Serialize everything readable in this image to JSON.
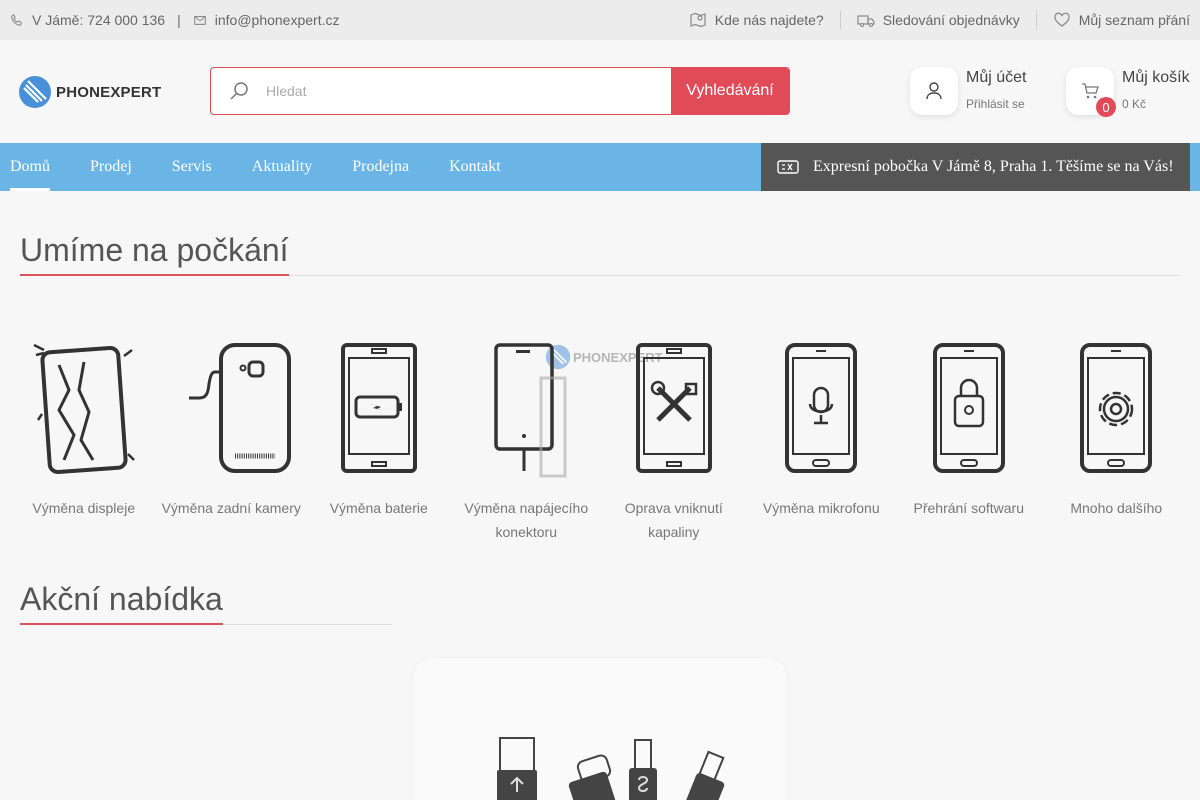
{
  "topbar": {
    "phone": "V Jámě: 724 000 136",
    "separator": "|",
    "email": "info@phonexpert.cz",
    "find_us": "Kde nás najdete?",
    "track_order": "Sledování objednávky",
    "wishlist": "Můj seznam přání"
  },
  "header": {
    "logo_text": "PHONEXPERT",
    "search_placeholder": "Hledat",
    "search_button": "Vyhledávání",
    "account_title": "Můj účet",
    "account_sub": "Přihlásit se",
    "cart_title": "Můj košík",
    "cart_sub": "0 Kč",
    "cart_count": "0"
  },
  "nav": {
    "items": [
      "Domů",
      "Prodej",
      "Servis",
      "Aktuality",
      "Prodejna",
      "Kontakt"
    ],
    "promo": "Expresní pobočka V Jámě 8, Praha 1. Těšíme se na Vás!"
  },
  "services": {
    "title": "Umíme na počkání",
    "items": [
      "Výměna displeje",
      "Výměna zadní kamery",
      "Výměna baterie",
      "Výměna napájecího konektoru",
      "Oprava vniknutí kapaliny",
      "Výměna mikrofonu",
      "Přehrání softwaru",
      "Mnoho dalšího"
    ]
  },
  "offers": {
    "title": "Akční nabídka"
  },
  "colors": {
    "accent": "#e04b57",
    "nav": "#6bb5e6",
    "promo_bg": "#555555",
    "logo": "#4a90d9"
  }
}
